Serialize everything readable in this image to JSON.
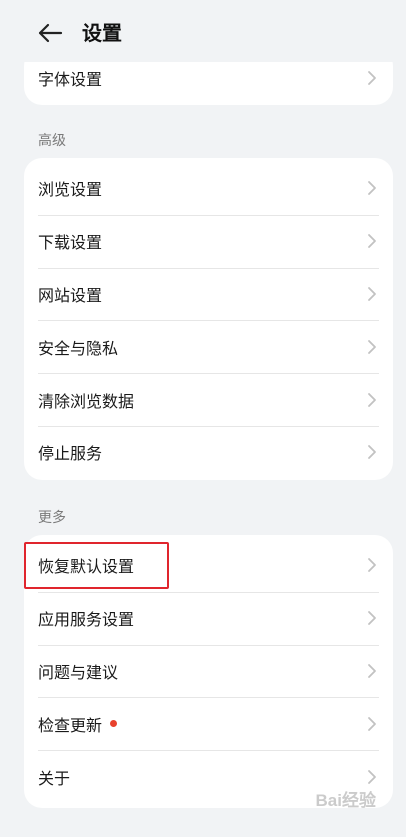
{
  "header": {
    "title": "设置"
  },
  "top_group": {
    "items": [
      {
        "label": "字体设置"
      }
    ]
  },
  "advanced": {
    "title": "高级",
    "items": [
      {
        "label": "浏览设置"
      },
      {
        "label": "下载设置"
      },
      {
        "label": "网站设置"
      },
      {
        "label": "安全与隐私"
      },
      {
        "label": "清除浏览数据"
      },
      {
        "label": "停止服务"
      }
    ]
  },
  "more": {
    "title": "更多",
    "items": [
      {
        "label": "恢复默认设置"
      },
      {
        "label": "应用服务设置"
      },
      {
        "label": "问题与建议"
      },
      {
        "label": "检查更新",
        "badge": "red-dot"
      },
      {
        "label": "关于"
      }
    ]
  },
  "watermark": "Bai经验",
  "colors": {
    "accent_highlight": "#e0252d",
    "badge": "#e8412c",
    "background": "#f1f3f5"
  }
}
